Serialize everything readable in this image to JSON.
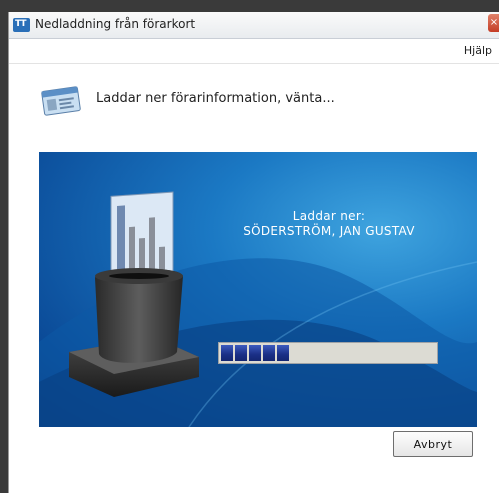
{
  "window": {
    "title": "Nedladdning från förarkort",
    "icon_text": "TT",
    "close_glyph": "×"
  },
  "menu": {
    "help": "Hjälp"
  },
  "header": {
    "status": "Laddar ner förarinformation, vänta..."
  },
  "download": {
    "label": "Laddar ner:",
    "driver_name": "SÖDERSTRÖM, JAN GUSTAV",
    "progress_blocks_filled": 5,
    "progress_blocks_total": 15
  },
  "buttons": {
    "cancel": "Avbryt"
  },
  "icons": [
    "card-reader-icon",
    "driver-card-icon",
    "close-icon"
  ],
  "colors": {
    "panel_blue": "#1b79c4",
    "progress_fill": "#1a2f86",
    "progress_track": "#dcdbd3"
  }
}
